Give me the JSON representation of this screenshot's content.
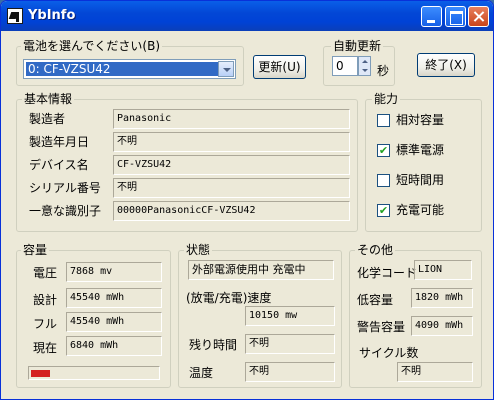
{
  "window": {
    "title": "YbInfo"
  },
  "battery_select": {
    "label": "電池を選んでください(B)",
    "selected": "0: CF-VZSU42"
  },
  "buttons": {
    "update": "更新(U)",
    "exit": "終了(X)"
  },
  "auto_update": {
    "label": "自動更新",
    "value": "0",
    "unit": "秒"
  },
  "basic_info": {
    "title": "基本情報",
    "rows": [
      {
        "label": "製造者",
        "value": "Panasonic"
      },
      {
        "label": "製造年月日",
        "value": "不明"
      },
      {
        "label": "デバイス名",
        "value": "CF-VZSU42"
      },
      {
        "label": "シリアル番号",
        "value": "不明"
      },
      {
        "label": "一意な識別子",
        "value": "00000PanasonicCF-VZSU42"
      }
    ]
  },
  "capability": {
    "title": "能力",
    "items": [
      {
        "label": "相対容量",
        "checked": false
      },
      {
        "label": "標準電源",
        "checked": true
      },
      {
        "label": "短時間用",
        "checked": false
      },
      {
        "label": "充電可能",
        "checked": true
      }
    ]
  },
  "capacity": {
    "title": "容量",
    "rows": [
      {
        "label": "電圧",
        "value": "7868 mv"
      },
      {
        "label": "設計",
        "value": "45540 mWh"
      },
      {
        "label": "フル",
        "value": "45540 mWh"
      },
      {
        "label": "現在",
        "value": "6840 mWh"
      }
    ],
    "charge_fraction": 0.15
  },
  "status": {
    "title": "状態",
    "power_state": "外部電源使用中 充電中",
    "rate_label": "(放電/充電)速度",
    "rate_value": "10150 mw",
    "remaining_label": "残り時間",
    "remaining_value": "不明",
    "temp_label": "温度",
    "temp_value": "不明"
  },
  "other": {
    "title": "その他",
    "chemistry_label": "化学コード",
    "chemistry_value": "LION",
    "low_label": "低容量",
    "low_value": "1820 mWh",
    "warn_label": "警告容量",
    "warn_value": "4090 mWh",
    "cycle_label": "サイクル数",
    "cycle_value": "不明"
  }
}
